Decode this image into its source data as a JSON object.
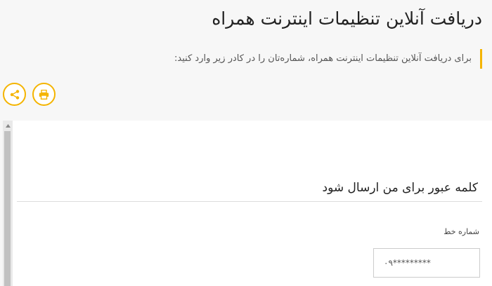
{
  "header": {
    "title": "دریافت آنلاین تنظیمات اینترنت همراه",
    "intro": "برای دریافت آنلاین تنظیمات اینترنت همراه، شماره‌تان را در کادر زیر وارد کنید:"
  },
  "actions": {
    "items": [
      {
        "name": "share",
        "icon": "share-icon"
      },
      {
        "name": "print",
        "icon": "printer-icon"
      }
    ],
    "accent_color": "#f4b400"
  },
  "form": {
    "heading": "کلمه عبور برای من ارسال شود",
    "phone_label": "شماره خط",
    "phone_placeholder": "۰۹*********"
  }
}
